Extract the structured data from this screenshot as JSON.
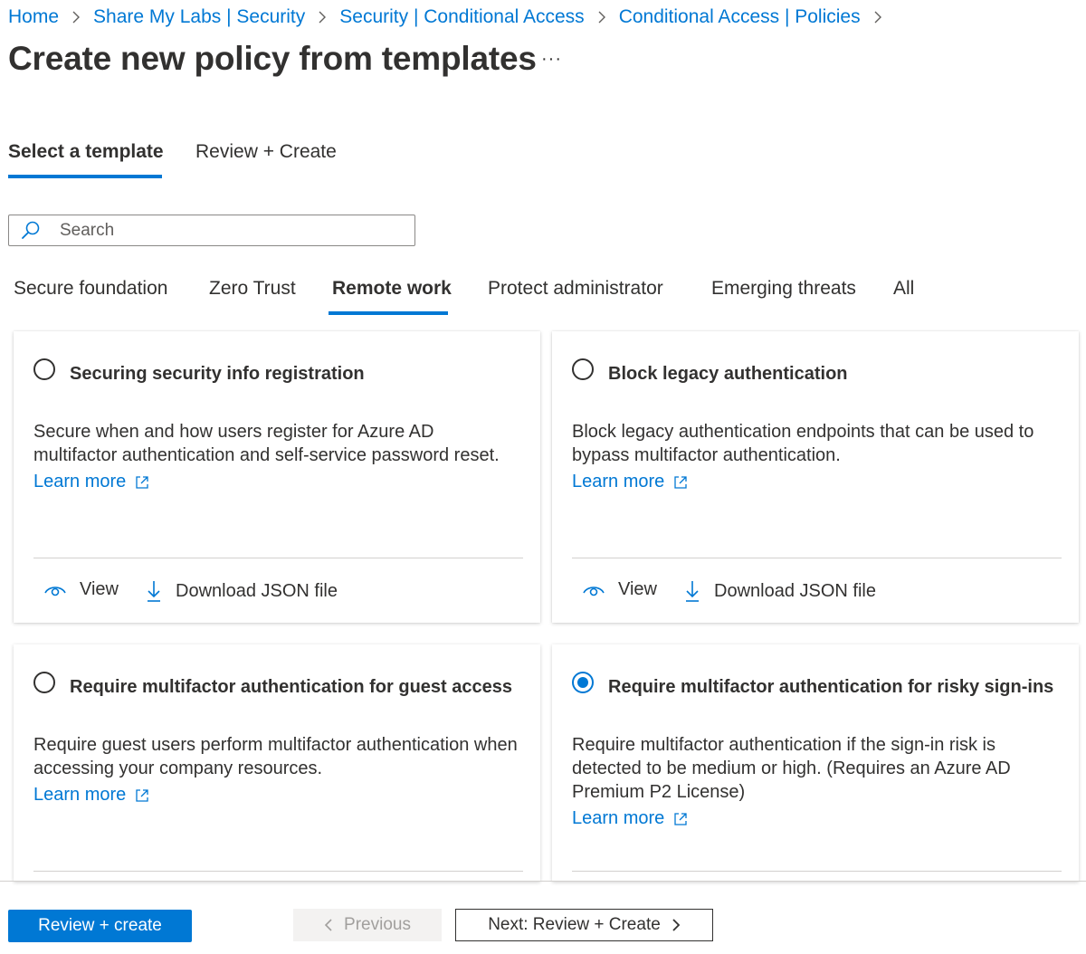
{
  "breadcrumb": {
    "items": [
      "Home",
      "Share My Labs | Security",
      "Security | Conditional Access",
      "Conditional Access | Policies"
    ]
  },
  "page": {
    "title": "Create new policy from templates",
    "more_label": "···"
  },
  "wizard_tabs": [
    {
      "label": "Select a template",
      "active": true
    },
    {
      "label": "Review + Create",
      "active": false
    }
  ],
  "search": {
    "placeholder": "Search",
    "value": ""
  },
  "categories": [
    {
      "label": "Secure foundation",
      "active": false
    },
    {
      "label": "Zero Trust",
      "active": false
    },
    {
      "label": "Remote work",
      "active": true
    },
    {
      "label": "Protect administrator",
      "active": false
    },
    {
      "label": "Emerging threats",
      "active": false
    },
    {
      "label": "All",
      "active": false
    }
  ],
  "templates": [
    {
      "title": "Securing security info registration",
      "description": "Secure when and how users register for Azure AD multifactor authentication and self-service password reset.",
      "learn_more": "Learn more",
      "view_label": "View",
      "download_label": "Download JSON file",
      "selected": false
    },
    {
      "title": "Block legacy authentication",
      "description": "Block legacy authentication endpoints that can be used to bypass multifactor authentication.",
      "learn_more": "Learn more",
      "view_label": "View",
      "download_label": "Download JSON file",
      "selected": false
    },
    {
      "title": "Require multifactor authentication for guest access",
      "description": "Require guest users perform multifactor authentication when accessing your company resources.",
      "learn_more": "Learn more",
      "selected": false
    },
    {
      "title": "Require multifactor authentication for risky sign-ins",
      "description": "Require multifactor authentication if the sign-in risk is detected to be medium or high. (Requires an Azure AD Premium P2 License)",
      "learn_more": "Learn more",
      "selected": true
    }
  ],
  "footer": {
    "review_create_label": "Review + create",
    "previous_label": "Previous",
    "next_label": "Next: Review + Create"
  },
  "colors": {
    "accent": "#0078d4",
    "text": "#323130",
    "disabled_text": "#a19f9d"
  }
}
